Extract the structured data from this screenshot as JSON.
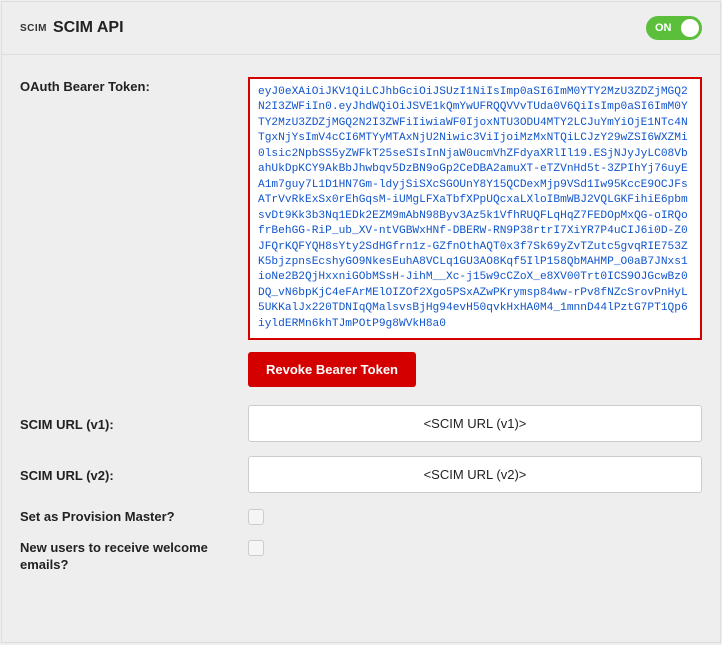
{
  "header": {
    "prefix": "SCIM",
    "title": "SCIM API",
    "toggle_label": "ON",
    "toggle_on": true
  },
  "oauth": {
    "label": "OAuth Bearer Token:",
    "token": "eyJ0eXAiOiJKV1QiLCJhbGciOiJSUzI1NiIsImp0aSI6ImM0YTY2MzU3ZDZjMGQ2N2I3ZWFiIn0.eyJhdWQiOiJSVE1kQmYwUFRQQVVvTUda0V6QiIsImp0aSI6ImM0YTY2MzU3ZDZjMGQ2N2I3ZWFiIiwiaWF0IjoxNTU3ODU4MTY2LCJuYmYiOjE1NTc4NTgxNjYsImV4cCI6MTYyMTAxNjU2Niwic3ViIjoiMzMxNTQiLCJzY29wZSI6WXZMi0lsic2NpbSS5yZWFkT25seSIsInNjaW0ucmVhZFdyaXRlIl19.ESjNJyJyLC08VbahUkDpKCY9AkBbJhwbqv5DzBN9oGp2CeDBA2amuXT-eTZVnHd5t-3ZPIhYj76uyEA1m7guy7L1D1HN7Gm-ldyjSiSXcSGOUnY8Y15QCDexMjp9VSd1Iw95KccE9OCJFsATrVvRkExSx0rEhGqsM-iUMgLFXaTbfXPpUQcxaLXloIBmWBJ2VQLGKFihiE6pbmsvDt9Kk3b3Nq1EDk2EZM9mAbN98Byv3Az5k1VfhRUQFLqHqZ7FEDOpMxQG-oIRQofrBehGG-RiP_ub_XV-ntVGBWxHNf-DBERW-RN9P38rtrI7XiYR7P4uCIJ6i0D-Z0JFQrKQFYQH8sYty2SdHGfrn1z-GZfnOthAQT0x3f7Sk69yZvTZutc5gvqRIE753ZK5bjzpnsEcshyGO9NkesEuhA8VCLq1GU3AO8Kqf5IlP158QbMAHMP_O0aB7JNxs1ioNe2B2QjHxxniGObMSsH-JihM__Xc-j15w9cCZoX_e8XV00Trt0ICS9OJGcwBz0DQ_vN6bpKjC4eFArMElOIZOf2Xgo5PSxAZwPKrymsp84ww-rPv8fNZcSrovPnHyL5UKKalJx220TDNIqQMalsvsBjHg94evH50qvkHxHA0M4_1mnnD44lPztG7PT1Qp6iyldERMn6khTJmPOtP9g8WVkH8a0",
    "revoke_label": "Revoke Bearer Token"
  },
  "urls": [
    {
      "label": "SCIM URL (v1):",
      "value": "<SCIM URL (v1)>"
    },
    {
      "label": "SCIM URL (v2):",
      "value": "<SCIM URL (v2)>"
    }
  ],
  "options": [
    {
      "label": "Set as Provision Master?",
      "checked": false
    },
    {
      "label": "New users to receive welcome emails?",
      "checked": false
    }
  ]
}
